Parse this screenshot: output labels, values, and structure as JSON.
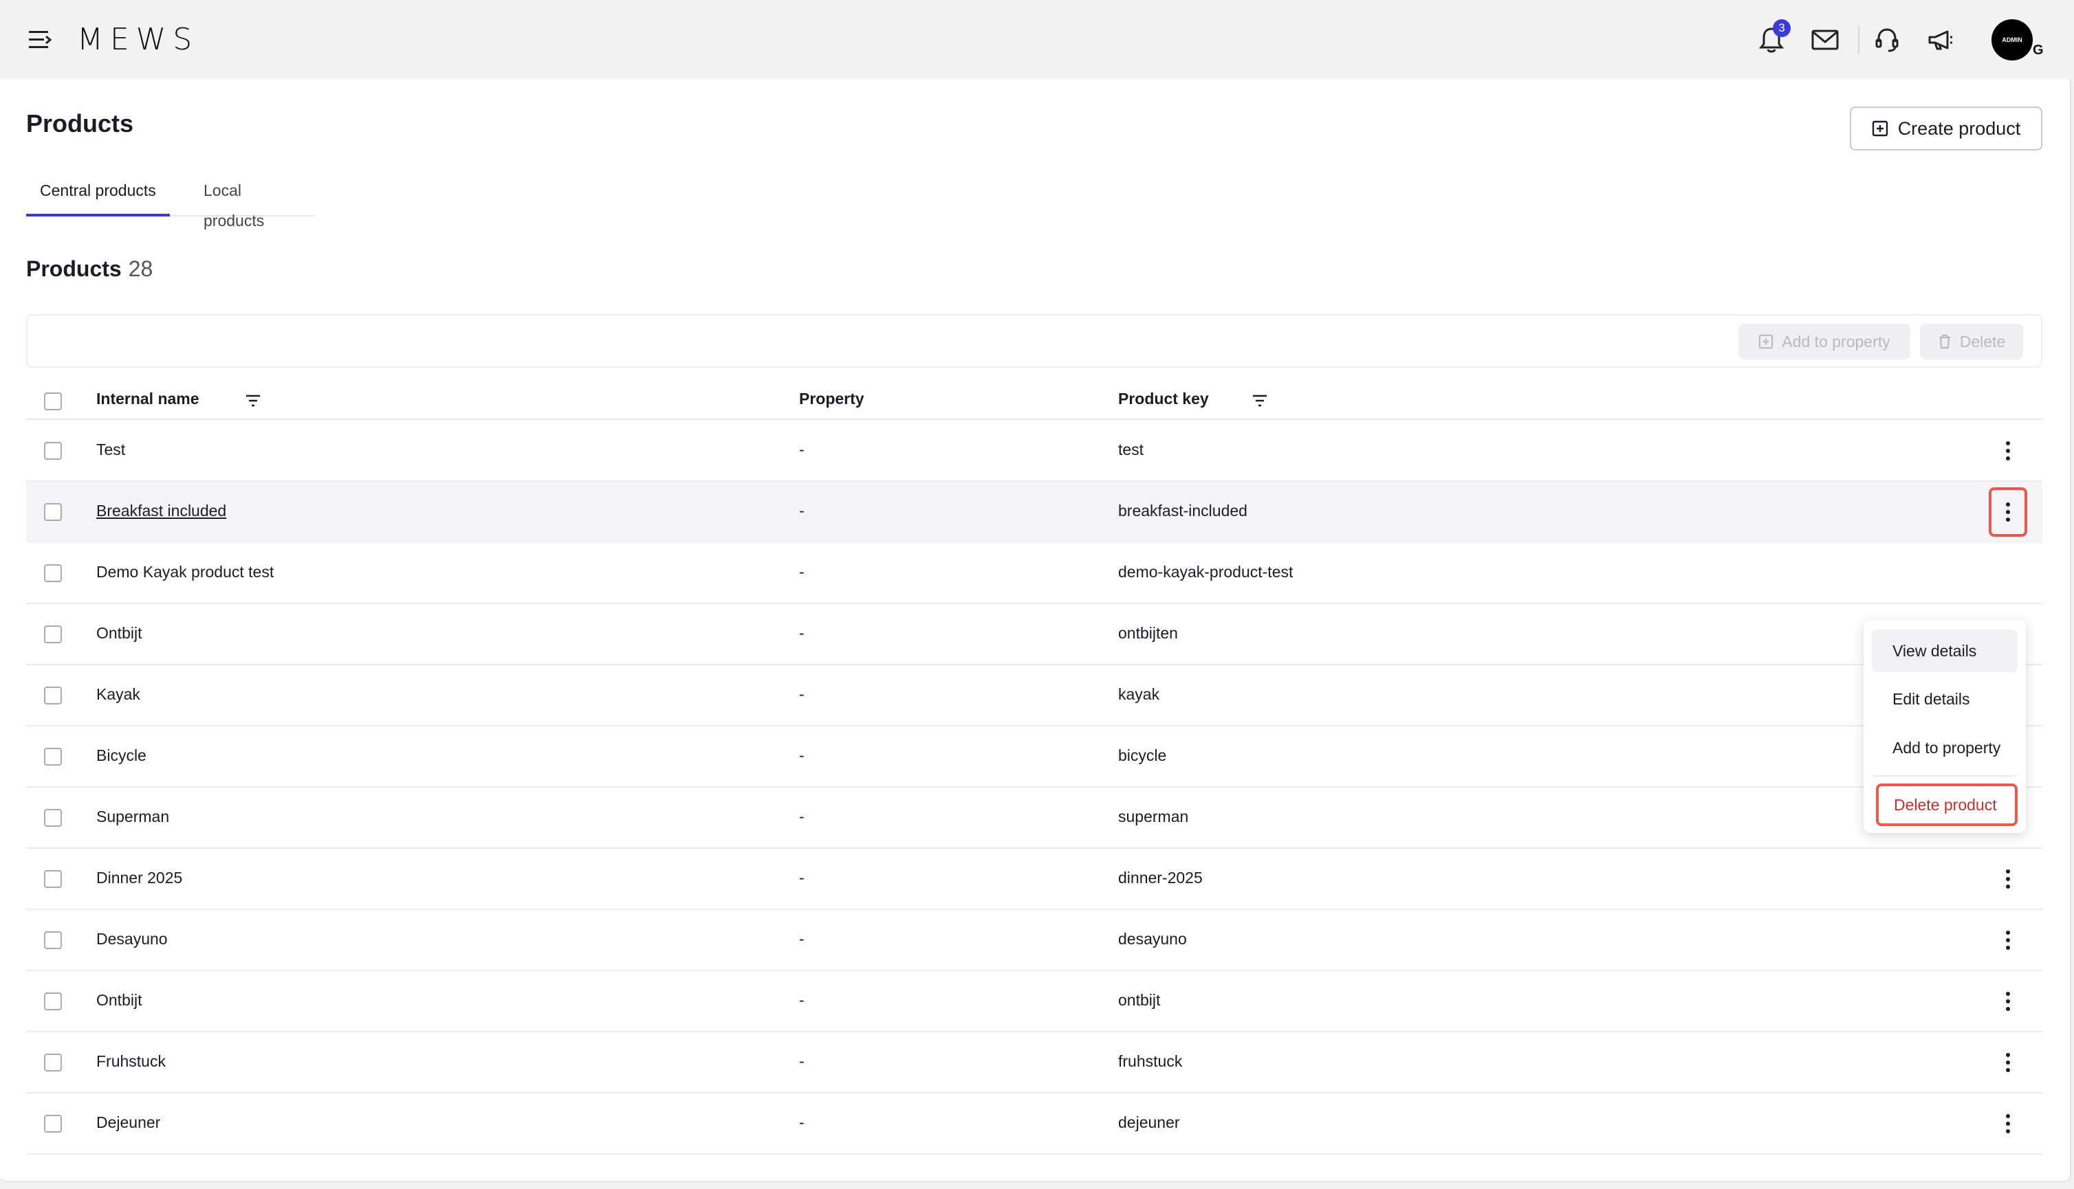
{
  "topbar": {
    "logo": "MEWS",
    "notifications_count": "3",
    "avatar_label": "ADMIN",
    "avatar_sub": "G"
  },
  "page": {
    "title": "Products",
    "create_button": "Create product",
    "tabs": [
      {
        "label": "Central products",
        "active": true
      },
      {
        "label": "Local products",
        "active": false
      }
    ],
    "section_title": "Products",
    "section_count": "28"
  },
  "toolbar": {
    "add_to_property": "Add to property",
    "delete": "Delete"
  },
  "table": {
    "columns": {
      "internal_name": "Internal name",
      "property": "Property",
      "product_key": "Product key"
    },
    "rows": [
      {
        "name": "Test",
        "property": "-",
        "key": "test"
      },
      {
        "name": "Breakfast included",
        "property": "-",
        "key": "breakfast-included"
      },
      {
        "name": "Demo Kayak product test",
        "property": "-",
        "key": "demo-kayak-product-test"
      },
      {
        "name": "Ontbijt",
        "property": "-",
        "key": "ontbijten"
      },
      {
        "name": "Kayak",
        "property": "-",
        "key": "kayak"
      },
      {
        "name": "Bicycle",
        "property": "-",
        "key": "bicycle"
      },
      {
        "name": "Superman",
        "property": "-",
        "key": "superman"
      },
      {
        "name": "Dinner 2025",
        "property": "-",
        "key": "dinner-2025"
      },
      {
        "name": "Desayuno",
        "property": "-",
        "key": "desayuno"
      },
      {
        "name": "Ontbijt",
        "property": "-",
        "key": "ontbijt"
      },
      {
        "name": "Fruhstuck",
        "property": "-",
        "key": "fruhstuck"
      },
      {
        "name": "Dejeuner",
        "property": "-",
        "key": "dejeuner"
      }
    ]
  },
  "row_menu": {
    "view_details": "View details",
    "edit_details": "Edit details",
    "add_to_property": "Add to property",
    "delete_product": "Delete product"
  },
  "colors": {
    "accent": "#3d3adb",
    "danger": "#c62f2f",
    "highlight_outline": "#e8584f"
  }
}
